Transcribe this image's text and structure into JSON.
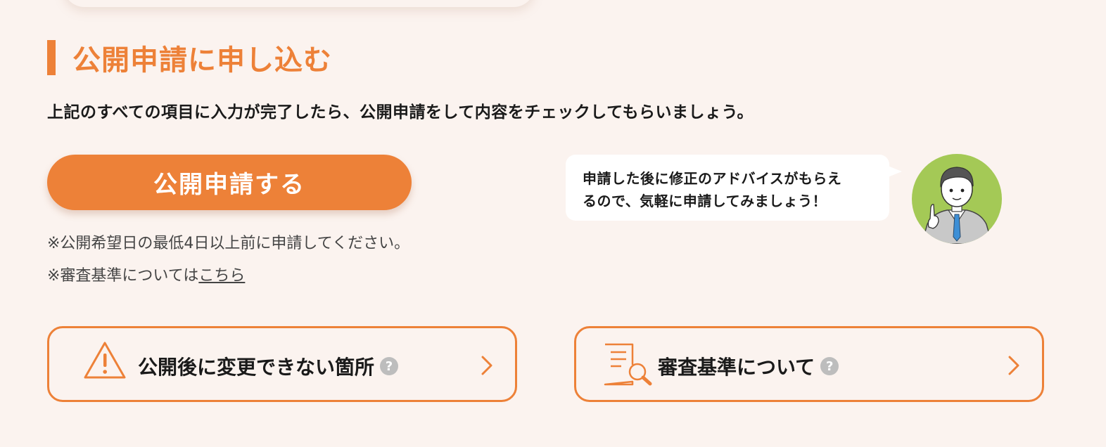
{
  "section": {
    "title": "公開申請に申し込む",
    "intro": "上記のすべての項目に入力が完了したら、公開申請をして内容をチェックしてもらいましょう。"
  },
  "apply_button": {
    "label": "公開申請する"
  },
  "notes": {
    "deadline": "※公開希望日の最低4日以上前に申請してください。",
    "criteria_prefix": "※審査基準については",
    "criteria_link": "こちら"
  },
  "advice": {
    "line1": "申請した後に修正のアドバイスがもらえ",
    "line2": "るので、気軽に申請してみましょう！"
  },
  "cards": [
    {
      "label": "公開後に変更できない箇所",
      "icon": "warning-icon",
      "help": "?"
    },
    {
      "label": "審査基準について",
      "icon": "document-search-icon",
      "help": "?"
    }
  ],
  "colors": {
    "accent": "#ed8138",
    "background": "#fbf3ef",
    "avatar_bg": "#a4c956"
  }
}
